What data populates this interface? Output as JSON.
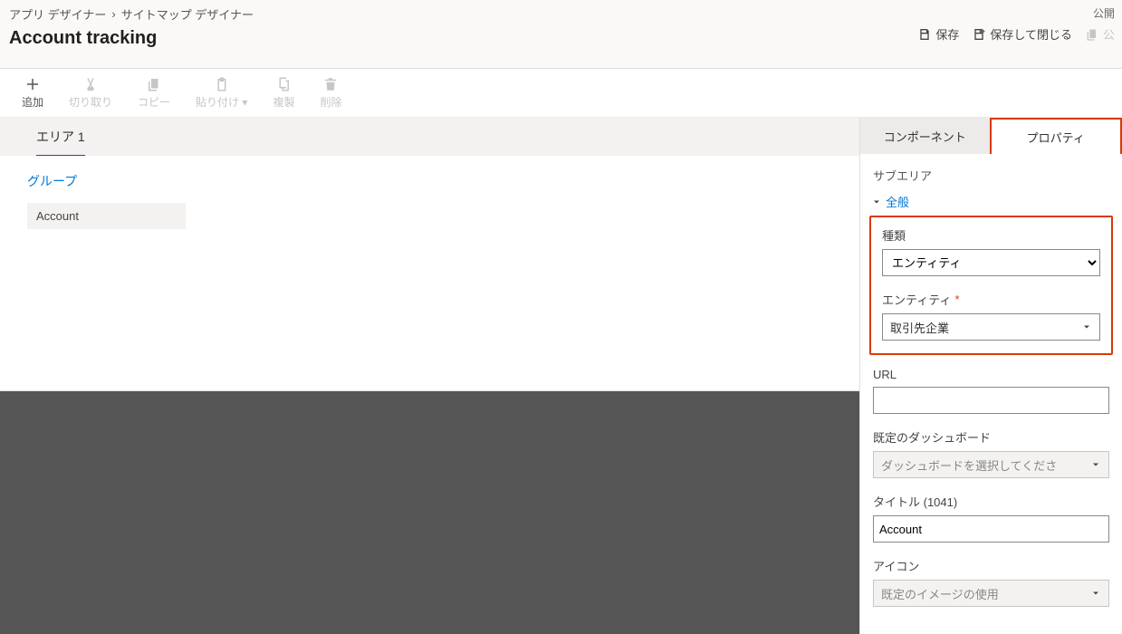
{
  "breadcrumb": {
    "parent": "アプリ デザイナー",
    "current": "サイトマップ デザイナー"
  },
  "title": "Account tracking",
  "header": {
    "publish": "公開",
    "save": "保存",
    "saveClose": "保存して閉じる",
    "clone": "公"
  },
  "toolbar": {
    "add": "追加",
    "cut": "切り取り",
    "copy": "コピー",
    "paste": "貼り付け",
    "pasteSuffix": "▾",
    "duplicate": "複製",
    "delete": "削除"
  },
  "canvas": {
    "area": "エリア 1",
    "group": "グループ",
    "subarea": "Account"
  },
  "tabs": {
    "components": "コンポーネント",
    "properties": "プロパティ"
  },
  "rail": {
    "title": "サブエリア",
    "section": "全般",
    "typeLabel": "種類",
    "typeValue": "エンティティ",
    "entityLabel": "エンティティ",
    "entityValue": "取引先企業",
    "urlLabel": "URL",
    "urlValue": "",
    "dashLabel": "既定のダッシュボード",
    "dashPlaceholder": "ダッシュボードを選択してくださ",
    "titleLabel": "タイトル (1041)",
    "titleValue": "Account",
    "iconLabel": "アイコン",
    "iconValue": "既定のイメージの使用"
  }
}
